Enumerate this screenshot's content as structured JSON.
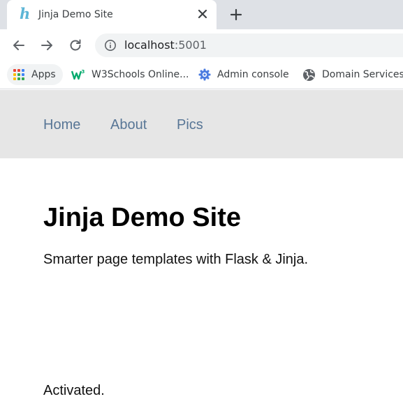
{
  "browser": {
    "tab": {
      "favicon": "h-italic-icon",
      "title": "Jinja Demo Site"
    },
    "address_bar": {
      "host": "localhost",
      "port": ":5001"
    },
    "bookmarks": [
      {
        "label": "Apps",
        "icon": "apps-grid-icon"
      },
      {
        "label": "W3Schools Online...",
        "icon": "w3schools-icon"
      },
      {
        "label": "Admin console",
        "icon": "admin-gear-icon"
      },
      {
        "label": "Domain Services",
        "icon": "globe-icon"
      }
    ]
  },
  "page": {
    "nav": [
      {
        "label": "Home"
      },
      {
        "label": "About"
      },
      {
        "label": "Pics"
      }
    ],
    "heading": "Jinja Demo Site",
    "subtitle": "Smarter page templates with Flask & Jinja.",
    "status": "Activated."
  },
  "colors": {
    "nav_link": "#587696",
    "navbar_bg": "#e6e6e6",
    "tab_strip_bg": "#dee1e6",
    "omnibox_bg": "#f1f3f4"
  }
}
